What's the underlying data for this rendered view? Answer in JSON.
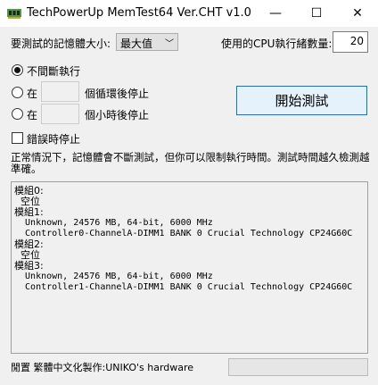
{
  "window": {
    "title": "TechPowerUp MemTest64 Ver.CHT v1.0",
    "minimize": "—",
    "maximize": "☐",
    "close": "✕"
  },
  "settings": {
    "mem_size_label": "要測試的記憶體大小:",
    "mem_size_value": "最大值",
    "cpu_threads_label": "使用的CPU執行緒數量:",
    "cpu_threads_value": "20"
  },
  "mode": {
    "infinite_label": "不間斷執行",
    "cycles_prefix": "在",
    "cycles_suffix": "個循環後停止",
    "hours_prefix": "在",
    "hours_suffix": "個小時後停止",
    "selected": "infinite"
  },
  "start_button_label": "開始測試",
  "stop_on_error_label": "錯誤時停止",
  "info_text": "正常情況下，記憶體會不斷測試，但你可以限制執行時間。測試時間越久檢測越準確。",
  "results": [
    {
      "text": "模組0:",
      "cjk": true
    },
    {
      "text": "  空位",
      "cjk": true
    },
    {
      "text": "模組1:",
      "cjk": true
    },
    {
      "text": "  Unknown, 24576 MB, 64-bit, 6000 MHz",
      "cjk": false
    },
    {
      "text": "  Controller0-ChannelA-DIMM1 BANK 0 Crucial Technology CP24G60C",
      "cjk": false
    },
    {
      "text": "模組2:",
      "cjk": true
    },
    {
      "text": "  空位",
      "cjk": true
    },
    {
      "text": "模組3:",
      "cjk": true
    },
    {
      "text": "  Unknown, 24576 MB, 64-bit, 6000 MHz",
      "cjk": false
    },
    {
      "text": "  Controller1-ChannelA-DIMM1 BANK 0 Crucial Technology CP24G60C",
      "cjk": false
    }
  ],
  "status_text": "閒置 繁體中文化製作:UNIKO's hardware",
  "icons": {
    "app": "memory-chip-icon",
    "dropdown": "chevron-down-icon"
  },
  "colors": {
    "start_button_border": "#0078d7",
    "start_button_bg": "#e5f1fb",
    "app_icon": "#4c9a3c"
  }
}
